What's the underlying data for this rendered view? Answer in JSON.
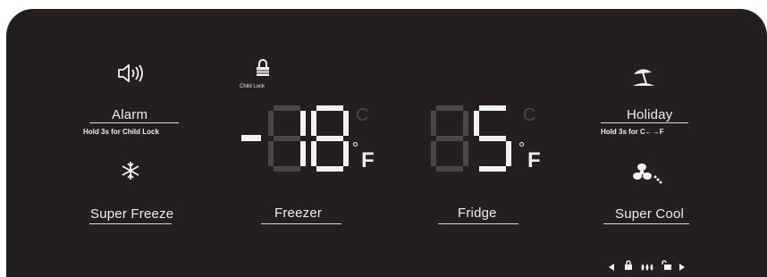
{
  "alarm": {
    "label": "Alarm",
    "hint": "Hold 3s for Child Lock",
    "icon": "speaker-sound-icon"
  },
  "child_lock": {
    "label": "Child Lock",
    "icon": "padlock-icon"
  },
  "holiday": {
    "label": "Holiday",
    "hint_prefix": "Hold 3s for ",
    "hint_symbol": "C←→F",
    "icon": "beach-umbrella-icon"
  },
  "super_freeze": {
    "label": "Super Freeze",
    "icon": "snowflake-icon"
  },
  "super_cool": {
    "label": "Super Cool",
    "icon": "fan-icon"
  },
  "freezer": {
    "label": "Freezer",
    "temperature": "-18",
    "unit_active": "F",
    "unit_inactive": "C",
    "degree": "°"
  },
  "fridge": {
    "label": "Fridge",
    "temperature": "5",
    "unit_active": "F",
    "unit_inactive": "C",
    "degree": "°"
  },
  "status_icons": [
    "left-arrow-icon",
    "lock-icon",
    "water-drops-icon",
    "unlock-icon",
    "right-arrow-icon"
  ],
  "colors": {
    "panel": "#231f1e",
    "lit": "#f2f2f2",
    "dim": "#4a4645"
  }
}
